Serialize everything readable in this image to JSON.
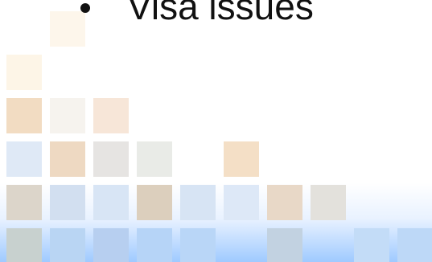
{
  "slide": {
    "bullet_text": "Visa issues"
  },
  "colors": {
    "text": "#111111",
    "gradient_top": "#ffffff",
    "gradient_mid": "#e7f1ff",
    "gradient_bottom": "#9ec9ff",
    "tile_peach": "#f3dcc0",
    "tile_cream": "#fbf0e1",
    "tile_blue": "#d6e6fb",
    "tile_gray": "#d4dbe5",
    "tile_tan": "#dcc9b1"
  }
}
